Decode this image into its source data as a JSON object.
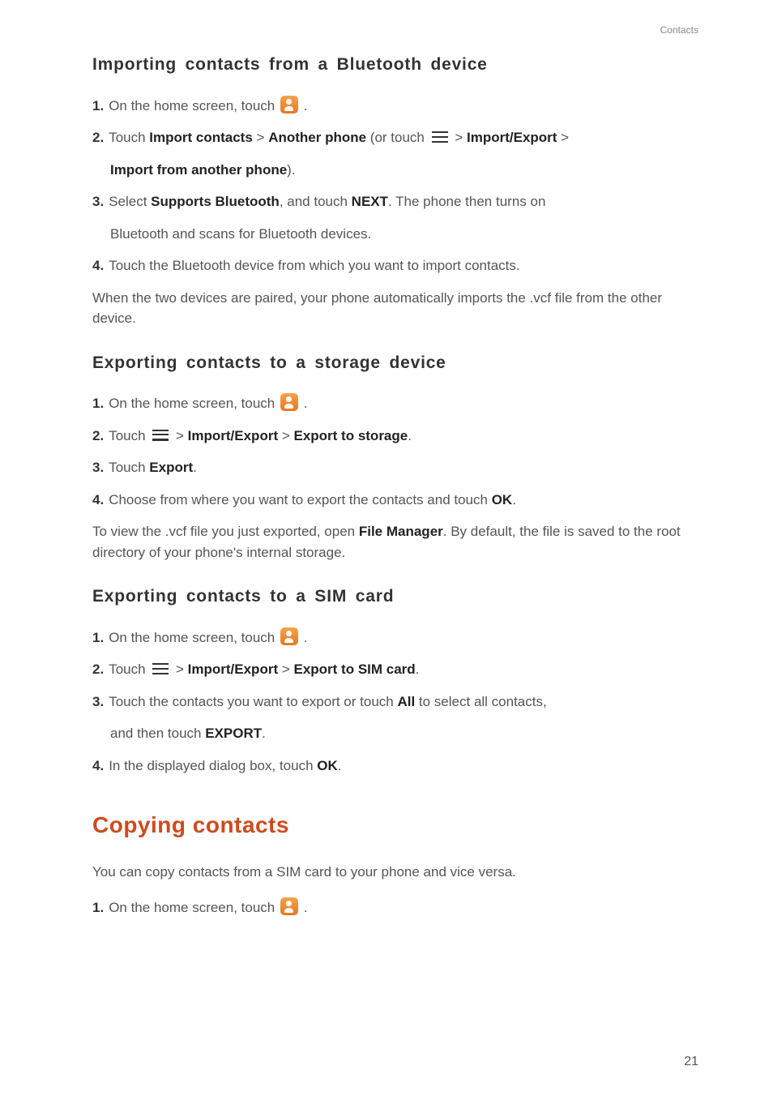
{
  "header": {
    "category": "Contacts"
  },
  "sec1": {
    "heading": "Importing contacts from a Bluetooth device",
    "s1_pre": "On the home screen, touch ",
    "s1_post": " .",
    "s2_a": "Touch ",
    "s2_b": "Import contacts",
    "s2_c": " > ",
    "s2_d": "Another phone",
    "s2_e": " (or touch ",
    "s2_f": " > ",
    "s2_g": "Import/Export",
    "s2_h": " > ",
    "s2_cont_a": "Import from another phone",
    "s2_cont_b": ").",
    "s3_a": "Select ",
    "s3_b": "Supports Bluetooth",
    "s3_c": ", and touch ",
    "s3_d": "NEXT",
    "s3_e": ". The phone then turns on",
    "s3_cont": "Bluetooth and scans for Bluetooth devices.",
    "s4": "Touch the Bluetooth device from which you want to import contacts.",
    "body": "When the two devices are paired, your phone automatically imports the .vcf file from the other device."
  },
  "sec2": {
    "heading": "Exporting contacts to a storage device",
    "s1_pre": "On the home screen, touch ",
    "s1_post": " .",
    "s2_a": "Touch ",
    "s2_b": " > ",
    "s2_c": "Import/Export",
    "s2_d": " > ",
    "s2_e": "Export to storage",
    "s2_f": ".",
    "s3_a": "Touch ",
    "s3_b": "Export",
    "s3_c": ".",
    "s4_a": "Choose from where you want to export the contacts and touch ",
    "s4_b": "OK",
    "s4_c": ".",
    "body_a": "To view the .vcf file you just exported, open ",
    "body_b": "File Manager",
    "body_c": ". By default, the file is saved to the root directory of your phone's internal storage."
  },
  "sec3": {
    "heading": "Exporting contacts to a SIM card",
    "s1_pre": "On the home screen, touch ",
    "s1_post": " .",
    "s2_a": "Touch ",
    "s2_b": " > ",
    "s2_c": "Import/Export",
    "s2_d": " > ",
    "s2_e": "Export to SIM card",
    "s2_f": ".",
    "s3_a": "Touch the contacts you want to export or touch ",
    "s3_b": "All",
    "s3_c": " to select all contacts,",
    "s3_cont_a": "and then touch ",
    "s3_cont_b": "EXPORT",
    "s3_cont_c": ".",
    "s4_a": "In the displayed dialog box, touch ",
    "s4_b": "OK",
    "s4_c": "."
  },
  "sec4": {
    "heading": "Copying contacts",
    "body": "You can copy contacts from a SIM card to your phone and vice versa.",
    "s1_pre": "On the home screen, touch ",
    "s1_post": " ."
  },
  "nums": {
    "n1": "1.",
    "n2": "2.",
    "n3": "3.",
    "n4": "4."
  },
  "page": "21"
}
